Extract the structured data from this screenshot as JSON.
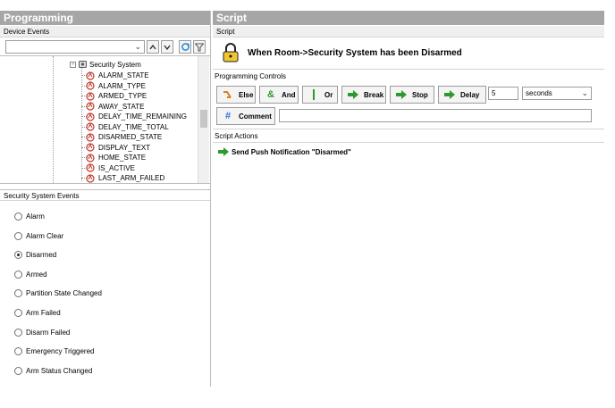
{
  "left_panel": {
    "title": "Programming",
    "device_events_label": "Device Events",
    "search_value": "",
    "tree_root": "Security System",
    "tree_items": [
      "ALARM_STATE",
      "ALARM_TYPE",
      "ARMED_TYPE",
      "AWAY_STATE",
      "DELAY_TIME_REMAINING",
      "DELAY_TIME_TOTAL",
      "DISARMED_STATE",
      "DISPLAY_TEXT",
      "HOME_STATE",
      "IS_ACTIVE",
      "LAST_ARM_FAILED"
    ],
    "events_label": "Security System Events",
    "events": [
      {
        "label": "Alarm",
        "selected": false
      },
      {
        "label": "Alarm Clear",
        "selected": false
      },
      {
        "label": "Disarmed",
        "selected": true
      },
      {
        "label": "Armed",
        "selected": false
      },
      {
        "label": "Partition State Changed",
        "selected": false
      },
      {
        "label": "Arm Failed",
        "selected": false
      },
      {
        "label": "Disarm Failed",
        "selected": false
      },
      {
        "label": "Emergency Triggered",
        "selected": false
      },
      {
        "label": "Arm Status Changed",
        "selected": false
      }
    ]
  },
  "right_panel": {
    "title": "Script",
    "script_label": "Script",
    "script_title": "When Room->Security System has been Disarmed",
    "controls_label": "Programming Controls",
    "buttons": {
      "else": "Else",
      "and": "And",
      "or": "Or",
      "break": "Break",
      "stop": "Stop",
      "delay": "Delay"
    },
    "delay_value": "5",
    "delay_unit": "seconds",
    "comment_label": "Comment",
    "comment_value": "",
    "actions_label": "Script Actions",
    "actions": [
      "Send Push Notification \"Disarmed\""
    ]
  },
  "colors": {
    "header": "#a6a6a6",
    "accent_green": "#2e9a2e",
    "event_icon": "#c0392b"
  }
}
